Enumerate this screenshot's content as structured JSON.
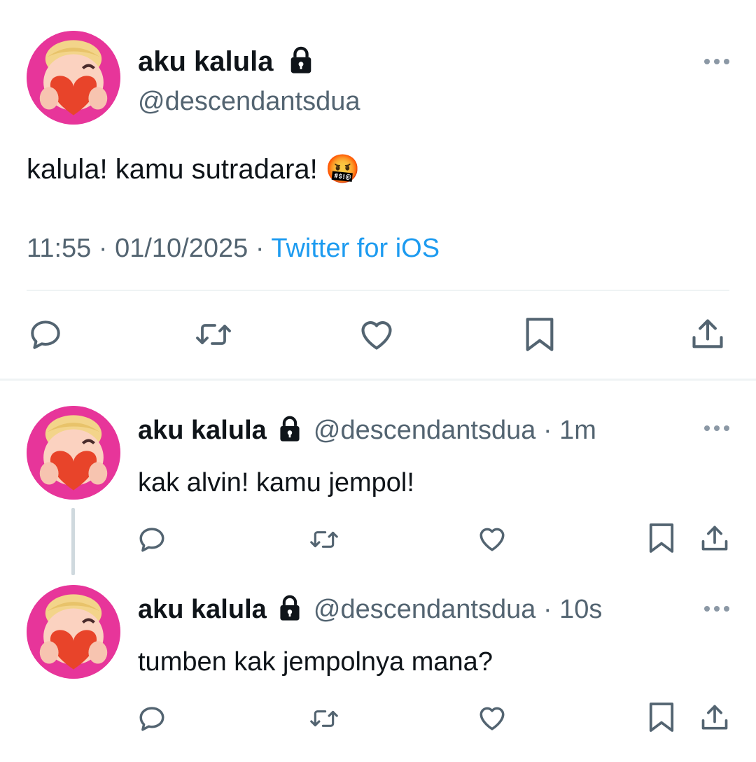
{
  "main_tweet": {
    "display_name": "aku kalula",
    "handle": "@descendantsdua",
    "text": "kalula! kamu sutradara! 🤬",
    "time": "11:55",
    "date": "01/10/2025",
    "source": "Twitter for iOS",
    "separator": "·"
  },
  "replies": [
    {
      "display_name": "aku kalula",
      "handle": "@descendantsdua",
      "age": "1m",
      "text": "kak alvin! kamu jempol!"
    },
    {
      "display_name": "aku kalula",
      "handle": "@descendantsdua",
      "age": "10s",
      "text": "tumben kak jempolnya mana?"
    }
  ],
  "icons": {
    "lock": "lock-icon",
    "more": "more-horizontal-icon",
    "reply": "reply-icon",
    "retweet": "retweet-icon",
    "like": "like-icon",
    "bookmark": "bookmark-icon",
    "share": "share-icon"
  },
  "colors": {
    "avatar_bg": "#e7359a",
    "link": "#1d9bf0",
    "secondary_text": "#536471",
    "icon": "#536471"
  }
}
